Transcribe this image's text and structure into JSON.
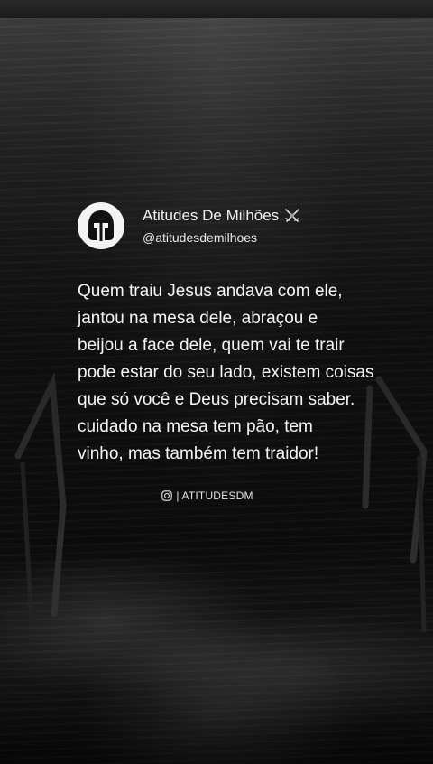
{
  "post": {
    "display_name": "Atitudes De Milhões",
    "badge_icon": "crossed-swords-icon",
    "handle": "@atitudesdemilhoes",
    "avatar_icon": "spartan-helmet-icon",
    "quote": "Quem traiu Jesus andava com ele,\njantou na mesa dele, abraçou e\nbeijou a face dele, quem vai te trair\npode estar do seu lado, existem coisas\nque só você e Deus precisam saber.\ncuidado na mesa tem pão, tem\nvinho, mas também tem traidor!",
    "footer_icon": "instagram-icon",
    "footer_label": "| ATITUDESDM"
  },
  "colors": {
    "text": "#f5f5f5",
    "avatar_bg": "#f4f4f4",
    "background": "#0a0a0a"
  }
}
